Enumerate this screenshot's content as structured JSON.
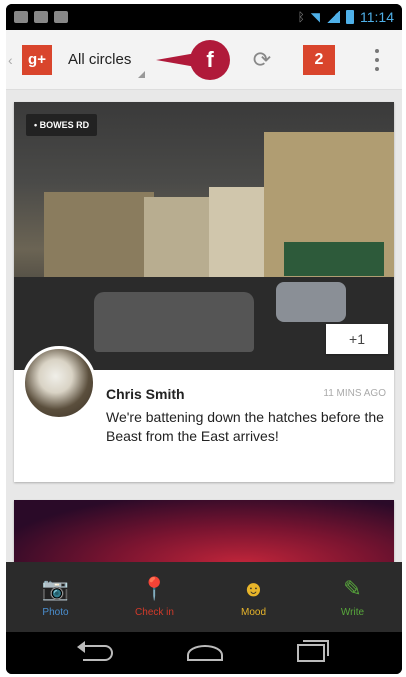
{
  "statusbar": {
    "time": "11:14",
    "icons": [
      "image-icon",
      "mail-icon",
      "android-icon"
    ],
    "right_icons": [
      "bluetooth-icon",
      "wifi-icon",
      "signal-icon",
      "battery-icon"
    ]
  },
  "actionbar": {
    "app_icon_text": "g+",
    "circle_selector": "All circles",
    "callout_glyph": "f",
    "refresh_glyph": "⟳",
    "notification_count": "2",
    "colors": {
      "gplus_red": "#d9452c",
      "callout": "#b01a3a"
    }
  },
  "post": {
    "location_chip": "• BOWES RD",
    "plus_one": "+1",
    "author": "Chris Smith",
    "time": "11 MINS AGO",
    "text": "We're battening down the hatches before the Beast from the East arrives!"
  },
  "bottombar": {
    "items": [
      {
        "label": "Photo",
        "icon": "camera-icon",
        "glyph": "📷",
        "color": "#4a8fd0"
      },
      {
        "label": "Check in",
        "icon": "location-pin-icon",
        "glyph": "📍",
        "color": "#d23a2a"
      },
      {
        "label": "Mood",
        "icon": "smiley-icon",
        "glyph": "☻",
        "color": "#e8b52a"
      },
      {
        "label": "Write",
        "icon": "pencil-icon",
        "glyph": "✎",
        "color": "#58a83c"
      }
    ]
  },
  "navbar": {
    "icons": [
      "back-icon",
      "home-icon",
      "recent-apps-icon"
    ]
  }
}
